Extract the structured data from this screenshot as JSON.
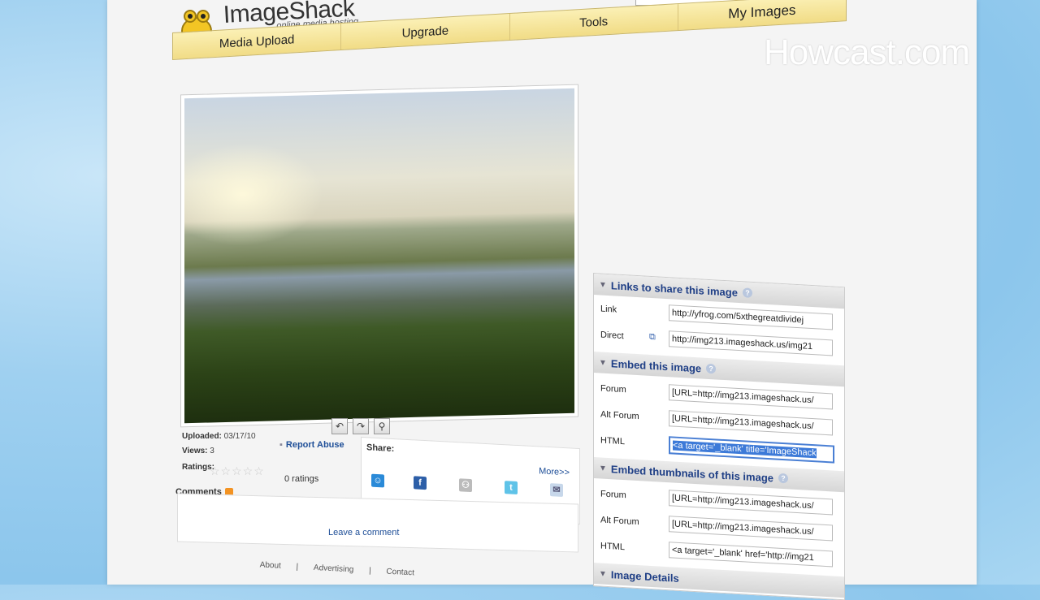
{
  "brand": {
    "name": "ImageShack",
    "tagline": "online media hosting"
  },
  "nav": {
    "tabs": [
      "Media Upload",
      "Upgrade",
      "Tools",
      "My Images"
    ]
  },
  "image_info": {
    "uploaded_label": "Uploaded:",
    "uploaded_value": "03/17/10",
    "views_label": "Views:",
    "views_value": "3",
    "ratings_label": "Ratings:",
    "ratings_count": "0 ratings",
    "report_abuse": "Report Abuse"
  },
  "share": {
    "label": "Share:",
    "more": "More>>"
  },
  "comments": {
    "title": "Comments",
    "leave": "Leave a comment"
  },
  "footer": {
    "links": [
      "About",
      "|",
      "Advertising",
      "|",
      "Contact"
    ]
  },
  "panel": {
    "links_section": {
      "title": "Links to share this image",
      "rows": [
        {
          "label": "Link",
          "value": "http://yfrog.com/5xthegreatdividej"
        },
        {
          "label": "Direct",
          "value": "http://img213.imageshack.us/img21"
        }
      ]
    },
    "embed_section": {
      "title": "Embed this image",
      "rows": [
        {
          "label": "Forum",
          "value": "[URL=http://img213.imageshack.us/"
        },
        {
          "label": "Alt Forum",
          "value": "[URL=http://img213.imageshack.us/"
        },
        {
          "label": "HTML",
          "value": "<a target='_blank' title='ImageShack"
        }
      ]
    },
    "thumbs_section": {
      "title": "Embed thumbnails of this image",
      "rows": [
        {
          "label": "Forum",
          "value": "[URL=http://img213.imageshack.us/"
        },
        {
          "label": "Alt Forum",
          "value": "[URL=http://img213.imageshack.us/"
        },
        {
          "label": "HTML",
          "value": "<a target='_blank' href='http://img21"
        }
      ]
    },
    "details_section": {
      "title": "Image Details"
    }
  },
  "watermark": "Howcast.com"
}
